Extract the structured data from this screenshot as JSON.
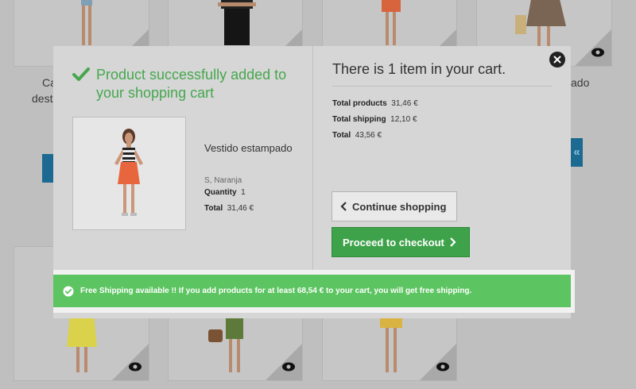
{
  "background": {
    "left_caption_1": "Ca",
    "left_caption_2": "deste",
    "right_caption": "ado",
    "right_button": "«"
  },
  "modal": {
    "success_message": "Product successfully added to your shopping cart",
    "product": {
      "name": "Vestido estampado",
      "attributes": "S, Naranja",
      "quantity_label": "Quantity",
      "quantity_value": "1",
      "total_label": "Total",
      "total_value": "31,46 €"
    },
    "cart": {
      "title": "There is 1 item in your cart.",
      "total_products_label": "Total products",
      "total_products_value": "31,46 €",
      "total_shipping_label": "Total shipping",
      "total_shipping_value": "12,10 €",
      "total_label": "Total",
      "total_value": "43,56 €"
    },
    "buttons": {
      "continue": "Continue shopping",
      "checkout": "Proceed to checkout"
    },
    "free_shipping": "Free Shipping available !! If you add products for at least 68,54 € to your cart, you will get free shipping."
  },
  "colors": {
    "success_green": "#46a74e",
    "checkout_green": "#3ea24a",
    "banner_green": "#5cc461",
    "overlay_gray": "#bfbfbf"
  },
  "icons": [
    "check-icon",
    "close-icon",
    "chevron-left-icon",
    "chevron-right-icon",
    "quick-view-eye-icon",
    "check-circle-icon"
  ]
}
